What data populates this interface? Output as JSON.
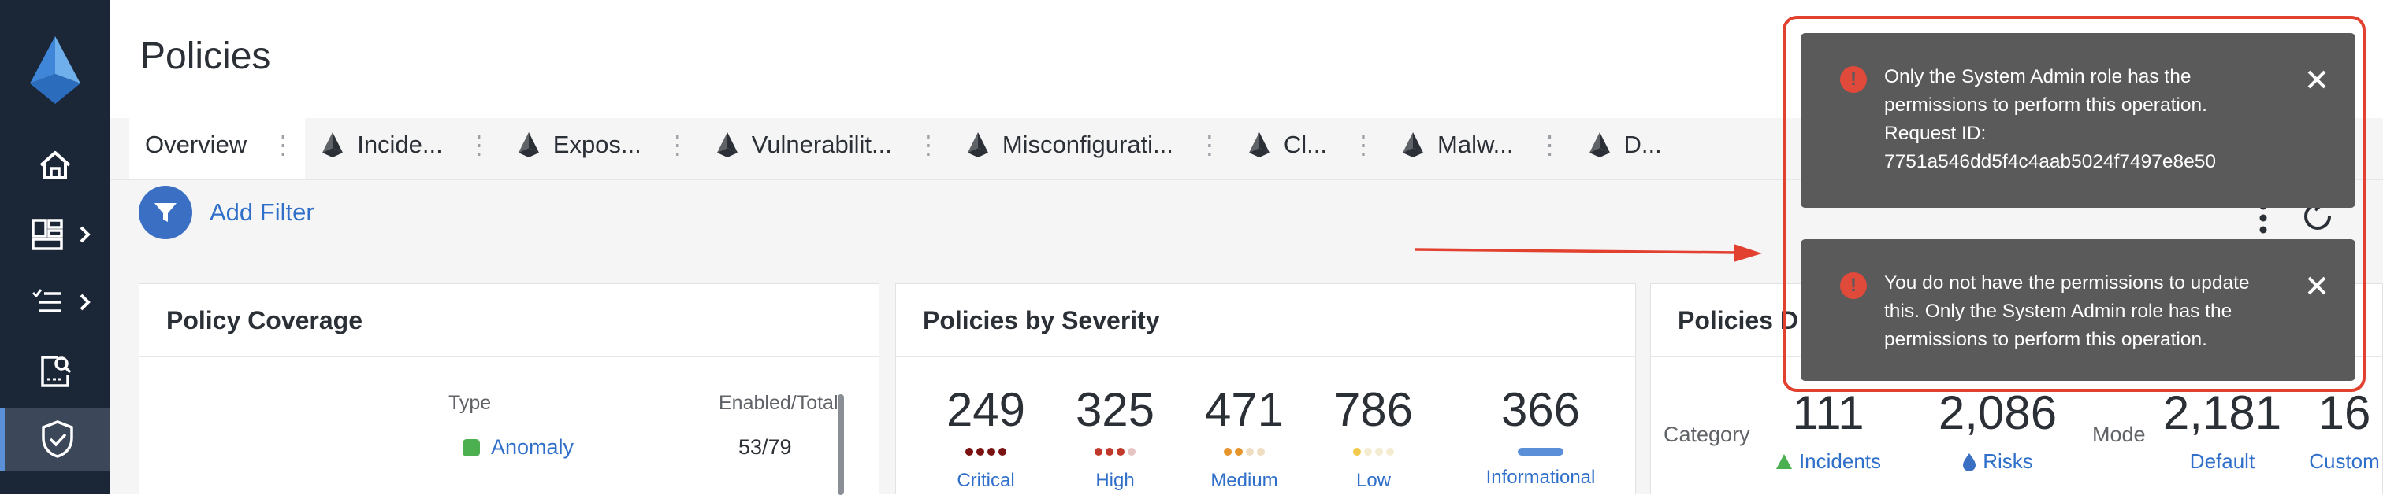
{
  "page": {
    "title": "Policies"
  },
  "sidebar": {
    "items": [
      {
        "icon": "home-icon"
      },
      {
        "icon": "dashboard-icon"
      },
      {
        "icon": "list-icon"
      },
      {
        "icon": "search-report-icon"
      },
      {
        "icon": "shield-check-icon",
        "active": true
      }
    ]
  },
  "tabs": [
    {
      "label": "Overview",
      "active": true,
      "icon": null
    },
    {
      "label": "Incide...",
      "icon": "prisma-icon"
    },
    {
      "label": "Expos...",
      "icon": "prisma-icon"
    },
    {
      "label": "Vulnerabilit...",
      "icon": "prisma-icon"
    },
    {
      "label": "Misconfigurati...",
      "icon": "prisma-icon"
    },
    {
      "label": "Cl...",
      "icon": "prisma-icon"
    },
    {
      "label": "Malw...",
      "icon": "prisma-icon"
    },
    {
      "label": "D...",
      "icon": "prisma-icon"
    }
  ],
  "filter": {
    "add_label": "Add Filter"
  },
  "coverage": {
    "title": "Policy Coverage",
    "col_type": "Type",
    "col_count": "Enabled/Total",
    "rows": [
      {
        "type": "Anomaly",
        "count": "53/79"
      }
    ]
  },
  "severity": {
    "title": "Policies by Severity",
    "items": [
      {
        "value": "249",
        "label": "Critical"
      },
      {
        "value": "325",
        "label": "High"
      },
      {
        "value": "471",
        "label": "Medium"
      },
      {
        "value": "786",
        "label": "Low"
      },
      {
        "value": "366",
        "label": "Informational"
      }
    ]
  },
  "distribution": {
    "title": "Policies D",
    "category_label": "Category",
    "mode_label": "Mode",
    "metrics": [
      {
        "value": "111",
        "label": "Incidents"
      },
      {
        "value": "2,086",
        "label": "Risks"
      },
      {
        "value": "2,181",
        "label": "Default"
      },
      {
        "value": "16",
        "label": "Custom"
      }
    ]
  },
  "notifications": [
    {
      "lines": [
        "Only the System Admin role has the",
        "permissions to perform this operation."
      ],
      "request_label": "Request ID:",
      "request_id": "7751a546dd5f4c4aab5024f7497e8e50"
    },
    {
      "lines": [
        "You do not have the permissions to update",
        "this. Only the System Admin role has the",
        "permissions to perform this operation."
      ]
    }
  ],
  "colors": {
    "sidebar_bg": "#1b2637",
    "accent": "#3a6fc4",
    "link": "#2f6fc9",
    "toast_bg": "#5a5a5a",
    "error": "#e04a3a",
    "annotation": "#e2412f"
  }
}
